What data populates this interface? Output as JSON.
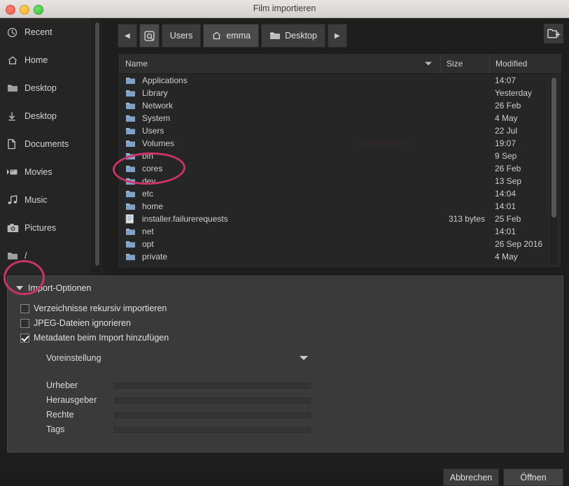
{
  "window": {
    "title": "Film importieren",
    "traffic_lights": [
      "close-button",
      "minimize-button",
      "maximize-button"
    ]
  },
  "sidebar": {
    "items": [
      {
        "label": "Recent",
        "icon": "clock-icon"
      },
      {
        "label": "Home",
        "icon": "home-icon"
      },
      {
        "label": "Desktop",
        "icon": "folder-icon"
      },
      {
        "label": "Desktop",
        "icon": "download-icon"
      },
      {
        "label": "Documents",
        "icon": "document-icon"
      },
      {
        "label": "Movies",
        "icon": "film-icon"
      },
      {
        "label": "Music",
        "icon": "music-note-icon"
      },
      {
        "label": "Pictures",
        "icon": "camera-icon"
      },
      {
        "label": "/",
        "icon": "folder-icon"
      }
    ]
  },
  "pathbar": {
    "back_label": "◀",
    "forward_label": "▶",
    "disk_icon": "hard-disk-icon",
    "crumbs": [
      {
        "label": "Users",
        "icon": "none",
        "active": false
      },
      {
        "label": "emma",
        "icon": "home-icon",
        "active": true
      },
      {
        "label": "Desktop",
        "icon": "folder-icon",
        "active": false
      }
    ],
    "new_folder_icon": "new-folder-icon"
  },
  "filelist": {
    "columns": [
      "Name",
      "Size",
      "Modified"
    ],
    "sort_indicator": "descending",
    "ghost_text": "Applications",
    "rows": [
      {
        "name": "Applications",
        "icon": "folder-icon",
        "size": "",
        "modified": "14:07"
      },
      {
        "name": "Library",
        "icon": "folder-icon",
        "size": "",
        "modified": "Yesterday"
      },
      {
        "name": "Network",
        "icon": "folder-icon",
        "size": "",
        "modified": "26 Feb"
      },
      {
        "name": "System",
        "icon": "folder-icon",
        "size": "",
        "modified": "4 May"
      },
      {
        "name": "Users",
        "icon": "folder-icon",
        "size": "",
        "modified": "22 Jul"
      },
      {
        "name": "Volumes",
        "icon": "folder-icon",
        "size": "",
        "modified": "19:07"
      },
      {
        "name": "bin",
        "icon": "folder-icon",
        "size": "",
        "modified": "9 Sep"
      },
      {
        "name": "cores",
        "icon": "folder-icon",
        "size": "",
        "modified": "26 Feb"
      },
      {
        "name": "dev",
        "icon": "folder-icon",
        "size": "",
        "modified": "13 Sep"
      },
      {
        "name": "etc",
        "icon": "folder-icon",
        "size": "",
        "modified": "14:04"
      },
      {
        "name": "home",
        "icon": "folder-icon",
        "size": "",
        "modified": "14:01"
      },
      {
        "name": "installer.failurerequests",
        "icon": "file-icon",
        "size": "313 bytes",
        "modified": "25 Feb"
      },
      {
        "name": "net",
        "icon": "folder-icon",
        "size": "",
        "modified": "14:01"
      },
      {
        "name": "opt",
        "icon": "folder-icon",
        "size": "",
        "modified": "26 Sep 2016"
      },
      {
        "name": "private",
        "icon": "folder-icon",
        "size": "",
        "modified": "4 May"
      }
    ]
  },
  "options": {
    "header": "Import-Optionen",
    "checkboxes": [
      {
        "label": "Verzeichnisse rekursiv importieren",
        "checked": false
      },
      {
        "label": "JPEG-Dateien ignorieren",
        "checked": false
      },
      {
        "label": "Metadaten beim Import hinzufügen",
        "checked": true
      }
    ],
    "preset_label": "Voreinstellung",
    "metadata_fields": [
      {
        "label": "Urheber",
        "value": ""
      },
      {
        "label": "Herausgeber",
        "value": ""
      },
      {
        "label": "Rechte",
        "value": ""
      },
      {
        "label": "Tags",
        "value": ""
      }
    ]
  },
  "footer": {
    "cancel_label": "Abbrechen",
    "open_label": "Öffnen"
  },
  "annotations": {
    "color": "#cc3366",
    "ellipses": [
      {
        "target": "Volumes"
      },
      {
        "target": "/"
      }
    ]
  }
}
